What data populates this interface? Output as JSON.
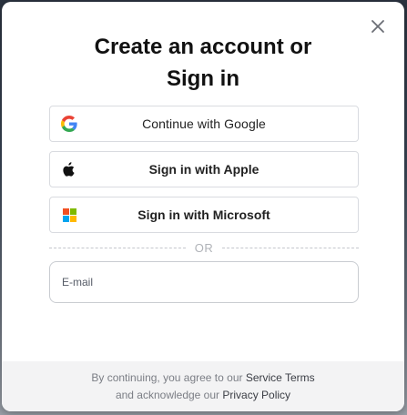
{
  "modal": {
    "title_line1": "Create an account or",
    "title_line2": "Sign in",
    "close_icon": "close-icon"
  },
  "auth_buttons": {
    "google": {
      "label": "Continue with Google",
      "icon": "google-icon"
    },
    "apple": {
      "label": "Sign in with Apple",
      "icon": "apple-icon"
    },
    "microsoft": {
      "label": "Sign in with Microsoft",
      "icon": "microsoft-icon"
    }
  },
  "divider": {
    "text": "OR"
  },
  "email": {
    "placeholder": "E-mail",
    "value": ""
  },
  "footer": {
    "text_before_terms": "By continuing, you agree to our ",
    "terms_link": "Service Terms",
    "text_before_privacy": "and acknowledge our ",
    "privacy_link": "Privacy Policy"
  },
  "colors": {
    "google_blue": "#4285F4",
    "google_red": "#EA4335",
    "google_yellow": "#FBBC05",
    "google_green": "#34A853",
    "ms_red": "#F25022",
    "ms_green": "#7FBA00",
    "ms_blue": "#00A4EF",
    "ms_yellow": "#FFB900"
  }
}
